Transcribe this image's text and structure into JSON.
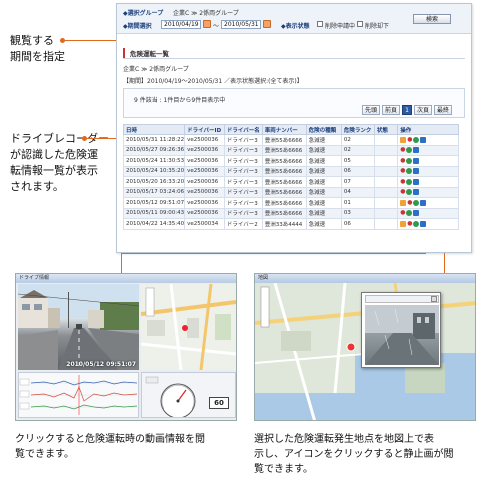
{
  "callouts": {
    "period": [
      "観覧する",
      "期間を指定"
    ],
    "list": [
      "ドライブレコーダー",
      "が認識した危険運",
      "転情報一覧が表示",
      "されます。"
    ]
  },
  "captions": {
    "video": [
      "クリックすると危険運転時の動画情報を閲",
      "覧できます。"
    ],
    "map": [
      "選択した危険運転発生地点を地図上で表",
      "示し、アイコンをクリックすると静止画が閲",
      "覧できます。"
    ]
  },
  "filter": {
    "group_label": "◆選択グループ",
    "group_value": "企業C ≫ 2係両グループ",
    "period_label": "◆期間選択",
    "date_from": "2010/04/19",
    "date_to": "2010/05/31",
    "tilde": "〜",
    "display_label": "◆表示状態",
    "check1": "削除申請中",
    "check2": "削除却下",
    "search_label": "検索"
  },
  "section": {
    "title": "危険運転一覧",
    "breadcrumb": "企業C ≫ 2係両グループ",
    "period_text": "【期間】2010/04/19〜2010/05/31 ／表示状態選択:(全て表示)】",
    "count_text": "9 件該当 : 1件目から9件目表示中",
    "pager": [
      "先頭",
      "前頁",
      "1",
      "次頁",
      "最終"
    ]
  },
  "table": {
    "columns": [
      "日時",
      "ドライバーID",
      "ドライバー名",
      "車両ナンバー",
      "危険の種類",
      "危険ランク",
      "状態",
      "操作"
    ],
    "rows": [
      [
        "2010/05/31 11:28:22",
        "ve2500036",
        "ドライバー3",
        "豊洲55あ6666",
        "急減速",
        "02",
        "",
        ""
      ],
      [
        "2010/05/27 09:26:36",
        "ve2500036",
        "ドライバー3",
        "豊洲55あ6666",
        "急減速",
        "02",
        "",
        ""
      ],
      [
        "2010/05/24 11:30:53",
        "ve2500036",
        "ドライバー3",
        "豊洲55あ6666",
        "急減速",
        "05",
        "",
        ""
      ],
      [
        "2010/05/24 10:35:20",
        "ve2500036",
        "ドライバー3",
        "豊洲55あ6666",
        "急減速",
        "06",
        "",
        ""
      ],
      [
        "2010/05/20 16:33:20",
        "ve2500036",
        "ドライバー3",
        "豊洲55あ6666",
        "急減速",
        "07",
        "",
        ""
      ],
      [
        "2010/05/17 03:24:06",
        "ve2500036",
        "ドライバー3",
        "豊洲55あ6666",
        "急減速",
        "04",
        "",
        ""
      ],
      [
        "2010/05/12 09:51:07",
        "ve2500036",
        "ドライバー3",
        "豊洲55あ6666",
        "急減速",
        "01",
        "",
        ""
      ],
      [
        "2010/05/11 09:00:43",
        "ve2500036",
        "ドライバー3",
        "豊洲55あ6666",
        "急減速",
        "03",
        "",
        ""
      ],
      [
        "2010/04/22 14:35:40",
        "ve2500034",
        "ドライバー2",
        "豊洲33あ4444",
        "急減速",
        "06",
        "",
        ""
      ]
    ]
  },
  "player": {
    "window_title": "ドライブ情報",
    "timestamp": "2010/05/12 09:51:07",
    "speed": "60"
  },
  "mapview": {
    "window_title": "地図"
  },
  "colors": {
    "accent_orange": "#e06a1b",
    "header_blue": "#1d3f7a",
    "row_stripe": "#eef3fa"
  }
}
